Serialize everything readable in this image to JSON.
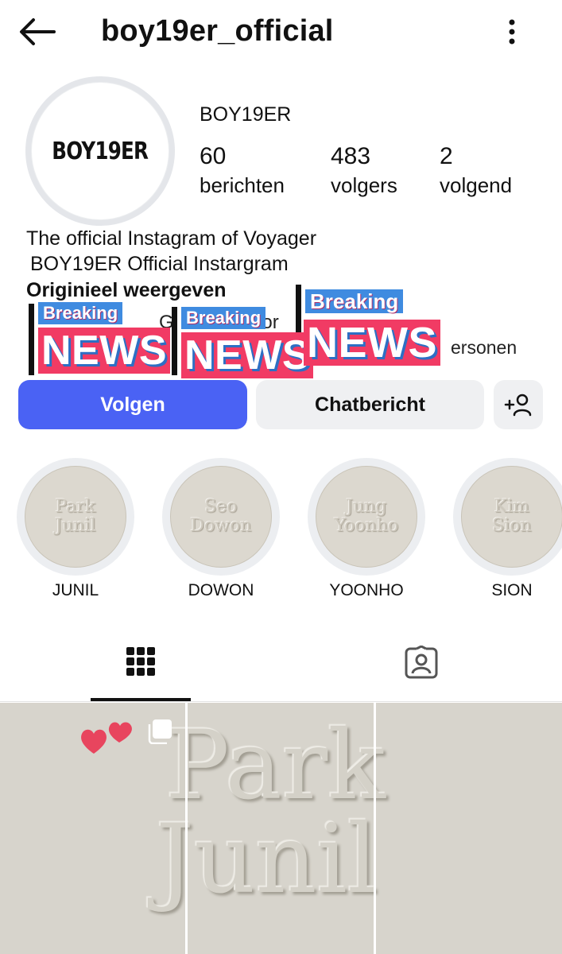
{
  "header": {
    "username": "boy19er_official",
    "back_icon": "arrow-left-icon",
    "menu_icon": "more-vertical-icon"
  },
  "profile": {
    "avatar_text": "BOY19ER",
    "display_name": "BOY19ER",
    "stats": [
      {
        "value": "60",
        "label": "berichten"
      },
      {
        "value": "483",
        "label": "volgers"
      },
      {
        "value": "2",
        "label": "volgend"
      }
    ],
    "bio_line1": "The official Instagram of Voyager",
    "bio_line2": "BOY19ER Official Instargram",
    "show_original": "Originieel weergeven",
    "partial_text_1": "G",
    "partial_text_2": "oor",
    "partial_text_3": "ersonen"
  },
  "stickers": {
    "breaking_label": "Breaking",
    "news_label": "NEWS",
    "colors": {
      "breaking": "#3f8be0",
      "news": "#f13b64"
    }
  },
  "actions": {
    "follow_label": "Volgen",
    "message_label": "Chatbericht",
    "add_user_icon": "add-person-icon",
    "follow_color": "#4a62f4"
  },
  "highlights": [
    {
      "cover_line1": "Park",
      "cover_line2": "Junil",
      "label": "JUNIL"
    },
    {
      "cover_line1": "Seo",
      "cover_line2": "Dowon",
      "label": "DOWON"
    },
    {
      "cover_line1": "Jung",
      "cover_line2": "Yoonho",
      "label": "YOONHO"
    },
    {
      "cover_line1": "Kim",
      "cover_line2": "Sion",
      "label": "SION"
    }
  ],
  "tabs": {
    "grid_icon": "grid-icon",
    "tagged_icon": "tagged-person-icon",
    "active": "grid"
  },
  "posts": {
    "text_line1": "Park",
    "text_line2": "Junil",
    "hearts_icon": "hearts-sticker-icon",
    "carousel_icon": "multiple-posts-icon"
  }
}
